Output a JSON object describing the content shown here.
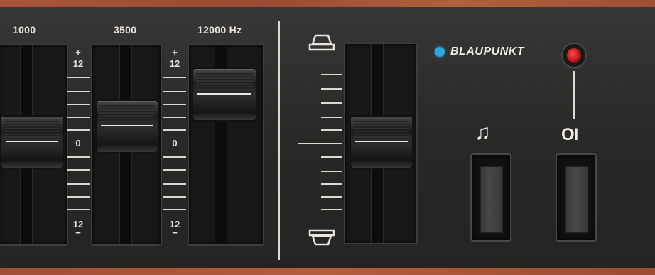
{
  "device": {
    "brand": "BLAUPUNKT",
    "colors": {
      "panel": "#2c2a29",
      "wood": "#a8553a",
      "brand_dot": "#2aa8e0",
      "power_led": "#d91c22",
      "markings": "#e8e5e0"
    }
  },
  "equalizer": {
    "bands": [
      {
        "label": "1000",
        "level": 0
      },
      {
        "label": "3500",
        "level": 0.15
      },
      {
        "label": "12000 Hz",
        "level": 0.45
      }
    ],
    "scale": {
      "plus": "+",
      "top": "12",
      "center": "0",
      "bottom": "12",
      "minus": "−"
    }
  },
  "balance": {
    "front_icon": "front-speaker-icon",
    "rear_icon": "rear-speaker-icon",
    "level": 0
  },
  "buttons": {
    "music_symbol": "♫",
    "power_symbol": "OI"
  }
}
